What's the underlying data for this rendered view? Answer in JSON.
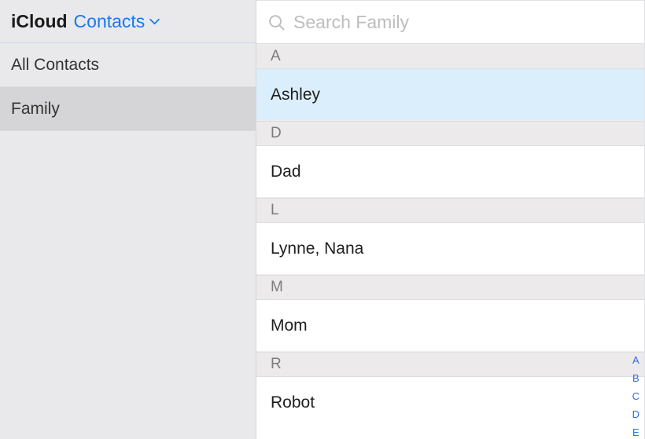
{
  "header": {
    "app_title": "iCloud",
    "dropdown_label": "Contacts"
  },
  "sidebar": {
    "groups": [
      {
        "label": "All Contacts",
        "selected": false
      },
      {
        "label": "Family",
        "selected": true
      }
    ]
  },
  "search": {
    "placeholder": "Search Family",
    "value": ""
  },
  "contacts": {
    "sections": [
      {
        "letter": "A",
        "items": [
          {
            "name": "Ashley",
            "selected": true
          }
        ]
      },
      {
        "letter": "D",
        "items": [
          {
            "name": "Dad",
            "selected": false
          }
        ]
      },
      {
        "letter": "L",
        "items": [
          {
            "name": "Lynne, Nana",
            "selected": false
          }
        ]
      },
      {
        "letter": "M",
        "items": [
          {
            "name": "Mom",
            "selected": false
          }
        ]
      },
      {
        "letter": "R",
        "items": [
          {
            "name": "Robot",
            "selected": false
          }
        ]
      }
    ]
  },
  "alpha_index": [
    "A",
    "B",
    "C",
    "D",
    "E"
  ]
}
